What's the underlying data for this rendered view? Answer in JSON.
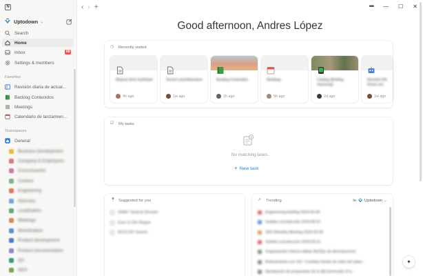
{
  "workspace": {
    "name": "Uptodown"
  },
  "sidebar": {
    "items": [
      {
        "label": "Search",
        "icon": "search-icon"
      },
      {
        "label": "Home",
        "icon": "home-icon"
      },
      {
        "label": "Inbox",
        "icon": "inbox-icon",
        "badge": "68"
      },
      {
        "label": "Settings & members",
        "icon": "gear-icon"
      }
    ],
    "favorites_title": "Favorites",
    "favorites": [
      {
        "label": "Revisión diaria de actual..."
      },
      {
        "label": "Backlog Contenidos"
      },
      {
        "label": "Meetings"
      },
      {
        "label": "Calendario de lanzamien..."
      }
    ],
    "teamspaces_title": "Teamspaces",
    "teamspace": {
      "label": "General"
    },
    "team_pages": [
      "Business Development",
      "Company & Employees",
      "Comunicación",
      "Content",
      "Engineering",
      "Glossary",
      "Localization",
      "Meetings",
      "Monetization",
      "Product development",
      "Product documentation",
      "QA",
      "SEO"
    ]
  },
  "main": {
    "greeting": "Good afternoon, Andres López",
    "recently_visited": {
      "title": "Recently visited",
      "cards": [
        {
          "title": "Mejorar ficha Surfshark",
          "time": "4h ago"
        },
        {
          "title": "Secret Land Adventure",
          "time": "1w ago"
        },
        {
          "title": "Backlog Contenidos",
          "time": "1h ago"
        },
        {
          "title": "Meetings",
          "time": "5h ago"
        },
        {
          "title": "Catalog (Briefing Samsung)",
          "time": "2d ago"
        },
        {
          "title": "Revisión EN fichas con",
          "time": "1w ago"
        }
      ]
    },
    "my_tasks": {
      "title": "My tasks",
      "empty_text": "No matching tasks.",
      "new_task_label": "New task"
    },
    "suggested": {
      "title": "Suggested for you",
      "items": [
        "SWAT Tactical Shooter",
        "Earn to Die Rogue",
        "ROCCAT Swarm"
      ]
    },
    "trending": {
      "title": "Trending",
      "filter_prefix": "In",
      "filter_value": "Uptodown",
      "items": [
        "Engineering briefing 2024.05.06",
        "Subida a producción 2024.05.07",
        "SEO Monthly Meeting 2024.05.06",
        "Subida a producción 2024.05.01",
        "Organización interna tablas MySQL de descripciones",
        "Refinamiento con 33+: Cambiar fuente de stats del adae...",
        "Aprobación de propuestas de la @Community of p..."
      ]
    }
  }
}
